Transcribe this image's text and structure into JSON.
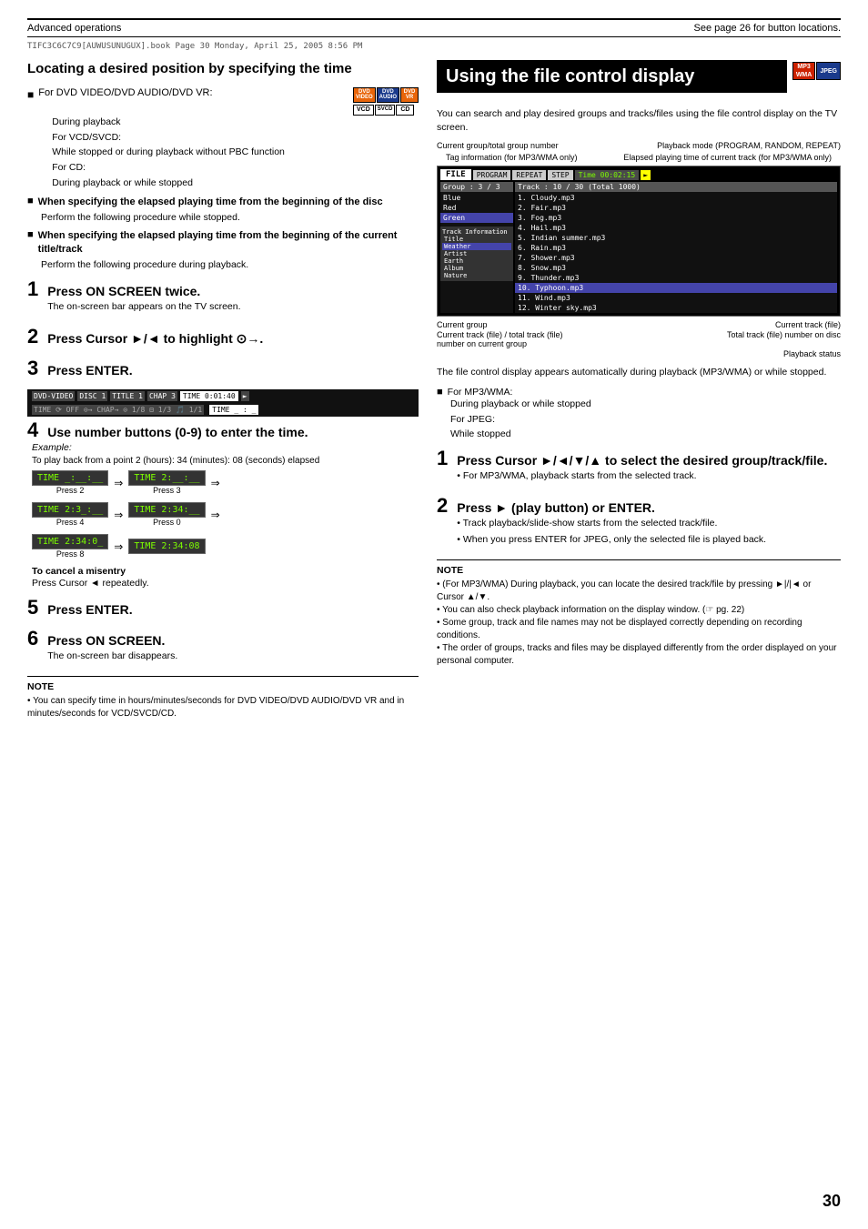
{
  "header": {
    "left_label": "Advanced operations",
    "right_label": "See page 26 for button locations."
  },
  "left_section": {
    "title": "Locating a desired position by specifying the time",
    "bullet1": {
      "symbol": "■",
      "text": "For DVD VIDEO/DVD AUDIO/DVD VR:",
      "items": [
        "During playback",
        "For VCD/SVCD:",
        "While stopped or during playback without PBC function",
        "For CD:",
        "During playback or while stopped"
      ]
    },
    "bullet2": {
      "symbol": "■",
      "bold_text": "When specifying the elapsed playing time from the beginning of the disc",
      "sub_text": "Perform the following procedure while stopped."
    },
    "bullet3": {
      "symbol": "■",
      "bold_text": "When specifying the elapsed playing time from the beginning of the current title/track",
      "sub_text": "Perform the following procedure during playback."
    },
    "steps": [
      {
        "num": "1",
        "title": "Press ON SCREEN twice.",
        "desc": "The on-screen bar appears on the TV screen."
      },
      {
        "num": "2",
        "title": "Press Cursor ►/◄ to highlight ⊙→.",
        "desc": ""
      },
      {
        "num": "3",
        "title": "Press ENTER.",
        "desc": ""
      }
    ],
    "step4": {
      "num": "4",
      "title": "Use number buttons (0-9) to enter the time.",
      "example_label": "Example:",
      "example_desc": "To play back from a point 2 (hours): 34 (minutes): 08 (seconds) elapsed",
      "time_rows": [
        {
          "from": "TIME _:__:__",
          "to": "TIME 2:__:__",
          "press": "Press 2",
          "press2": "Press 3"
        },
        {
          "from": "TIME 2:3_:__",
          "to": "TIME 2:34:__",
          "press": "Press 4",
          "press2": "Press 0"
        },
        {
          "from": "TIME 2:34:0_",
          "to": "TIME 2:34:08",
          "press": "Press 8"
        }
      ],
      "cancel_label": "To cancel a misentry",
      "cancel_desc": "Press Cursor ◄ repeatedly."
    },
    "step5": {
      "num": "5",
      "title": "Press ENTER."
    },
    "step6": {
      "num": "6",
      "title": "Press ON SCREEN.",
      "desc": "The on-screen bar disappears."
    },
    "note": {
      "title": "NOTE",
      "text": "• You can specify time in hours/minutes/seconds for DVD VIDEO/DVD AUDIO/DVD VR and in minutes/seconds for VCD/SVCD/CD."
    }
  },
  "right_section": {
    "title": "Using the file control display",
    "intro": "You can search and play desired groups and tracks/files using the file control display on the TV screen.",
    "annotations": {
      "top_left": "Current group/total group number",
      "top_right": "Playback mode (PROGRAM, RANDOM, REPEAT)",
      "tag_info": "Tag information (for MP3/WMA only)",
      "elapsed_time": "Elapsed playing time of current track (for MP3/WMA only)"
    },
    "screen": {
      "file_tab": "FILE",
      "mode_tabs": [
        "PROGRAM",
        "REPEAT",
        "STEP",
        "Time 00:02:15"
      ],
      "group_header": "Group : 3 / 3",
      "group_items": [
        "Blue",
        "Red",
        "Green"
      ],
      "track_header": "Track : 10 / 30 (Total 1000)",
      "tracks": [
        "1. Cloudy.mp3",
        "2. Fair.mp3",
        "3. Fog.mp3",
        "4. Hail.mp3",
        "5. Indian summer.mp3",
        "6. Rain.mp3",
        "7. Shower.mp3",
        "8. Snow.mp3",
        "9. Thunder.mp3",
        "10. Typhoon.mp3",
        "11. Wind.mp3",
        "12. Winter sky.mp3"
      ],
      "track_info_label": "Track Information",
      "track_info_items": [
        "Title",
        "Weather",
        "Artist",
        "Earth",
        "Album",
        "Nature"
      ]
    },
    "bottom_annotations": {
      "current_group": "Current group",
      "current_file": "Current track (file)",
      "current_track_file": "Current track (file) / total track (file) number on current group",
      "total_track": "Total track (file) number on disc",
      "playback_status": "Playback status"
    },
    "auto_display_text": "The file control display appears automatically during playback (MP3/WMA) or while stopped.",
    "bullets": [
      {
        "symbol": "■",
        "text": "For MP3/WMA:",
        "items": [
          "During playback or while stopped",
          "For JPEG:",
          "While stopped"
        ]
      }
    ],
    "steps": [
      {
        "num": "1",
        "title": "Press Cursor ►/◄/▼/▲ to select the desired group/track/file.",
        "desc": "• For MP3/WMA, playback starts from the selected track."
      },
      {
        "num": "2",
        "title": "Press ► (play button) or ENTER.",
        "descs": [
          "• Track playback/slide-show starts from the selected track/file.",
          "• When you press ENTER for JPEG, only the selected file is played back."
        ]
      }
    ],
    "note": {
      "title": "NOTE",
      "items": [
        "• (For MP3/WMA) During playback, you can locate the desired track/file by pressing ►|/|◄ or Cursor ▲/▼.",
        "• You can also check playback information on the display window. (☞ pg. 22)",
        "• Some group, track and file names may not be displayed correctly depending on recording conditions.",
        "• The order of groups, tracks and files may be displayed differently from the order displayed on your personal computer."
      ]
    }
  },
  "page_number": "30"
}
